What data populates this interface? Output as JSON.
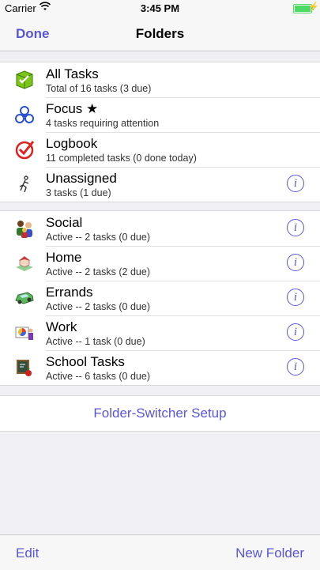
{
  "status_bar": {
    "carrier": "Carrier",
    "time": "3:45 PM",
    "battery_level": 1.0
  },
  "nav": {
    "left_button": "Done",
    "title": "Folders"
  },
  "system_folders": [
    {
      "icon": "all-tasks-icon",
      "title": "All Tasks",
      "subtitle": "Total of 16 tasks (3 due)"
    },
    {
      "icon": "focus-icon",
      "title": "Focus ★",
      "subtitle": "4 tasks requiring attention"
    },
    {
      "icon": "logbook-icon",
      "title": "Logbook",
      "subtitle": "11 completed tasks (0 done today)"
    },
    {
      "icon": "unassigned-icon",
      "title": "Unassigned",
      "subtitle": "3 tasks (1 due)"
    }
  ],
  "user_folders": [
    {
      "icon": "social-icon",
      "title": "Social",
      "subtitle": "Active -- 2 tasks (0 due)"
    },
    {
      "icon": "home-icon",
      "title": "Home",
      "subtitle": "Active -- 2 tasks (2 due)"
    },
    {
      "icon": "errands-icon",
      "title": "Errands",
      "subtitle": "Active -- 2 tasks (0 due)"
    },
    {
      "icon": "work-icon",
      "title": "Work",
      "subtitle": "Active -- 1 task (0 due)"
    },
    {
      "icon": "school-icon",
      "title": "School Tasks",
      "subtitle": "Active -- 6 tasks (0 due)"
    }
  ],
  "setup_button": "Folder-Switcher Setup",
  "toolbar": {
    "left": "Edit",
    "right": "New Folder"
  },
  "colors": {
    "accent": "#5856d6",
    "background": "#efeff4"
  }
}
